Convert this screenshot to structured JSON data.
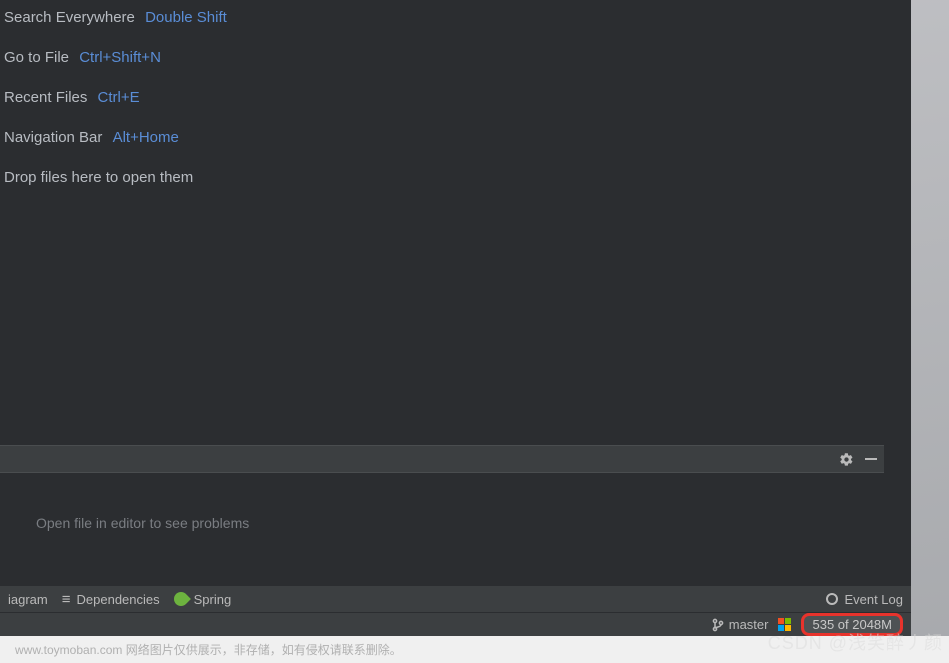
{
  "hints": [
    {
      "label": "Search Everywhere",
      "shortcut": "Double Shift"
    },
    {
      "label": "Go to File",
      "shortcut": "Ctrl+Shift+N"
    },
    {
      "label": "Recent Files",
      "shortcut": "Ctrl+E"
    },
    {
      "label": "Navigation Bar",
      "shortcut": "Alt+Home"
    }
  ],
  "drop_hint": "Drop files here to open them",
  "problems": {
    "empty_text": "Open file in editor to see problems"
  },
  "bottom_tabs": {
    "diagram": "iagram",
    "dependencies": "Dependencies",
    "spring": "Spring",
    "event_log": "Event Log"
  },
  "status": {
    "branch": "master",
    "memory": "535 of 2048M"
  },
  "footer": "www.toymoban.com 网络图片仅供展示，非存储，如有侵权请联系删除。",
  "watermark": "CSDN @浅笑醉丿颜"
}
